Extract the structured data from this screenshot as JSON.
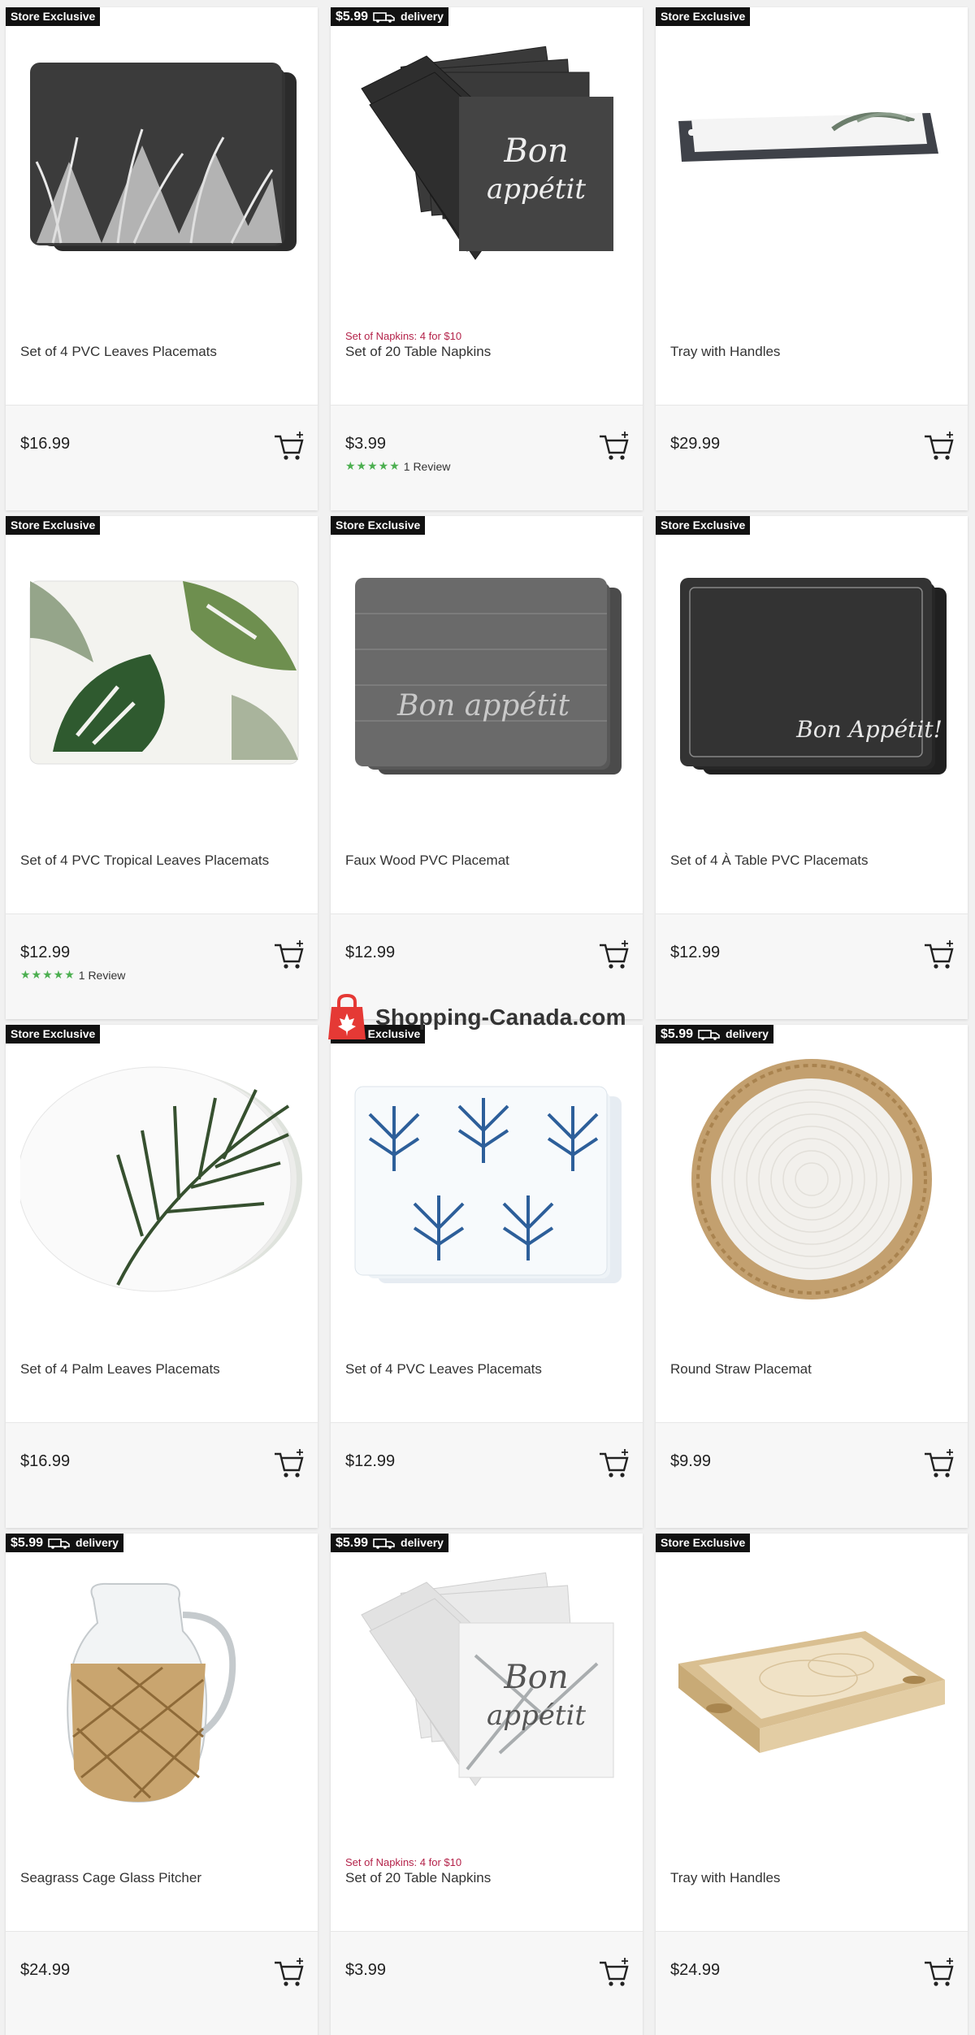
{
  "products": [
    {
      "badge": "Store Exclusive",
      "badge_type": "exclusive",
      "title": "Set of 4 PVC Leaves Placemats",
      "price": "$16.99",
      "promo": "",
      "rating": "",
      "image": "placemat-dark-leaves"
    },
    {
      "badge": "$5.99",
      "badge_type": "delivery",
      "title": "Set of 20 Table Napkins",
      "price": "$3.99",
      "promo": "Set of Napkins: 4 for $10",
      "rating": "1 Review",
      "image": "napkins-dark-bon-appetit"
    },
    {
      "badge": "Store Exclusive",
      "badge_type": "exclusive",
      "title": "Tray with Handles",
      "price": "$29.99",
      "promo": "",
      "rating": "",
      "image": "tray-dark"
    },
    {
      "badge": "Store Exclusive",
      "badge_type": "exclusive",
      "title": "Set of 4 PVC Tropical Leaves Placemats",
      "price": "$12.99",
      "promo": "",
      "rating": "1 Review",
      "image": "placemat-tropical"
    },
    {
      "badge": "Store Exclusive",
      "badge_type": "exclusive",
      "title": "Faux Wood PVC Placemat",
      "price": "$12.99",
      "promo": "",
      "rating": "",
      "image": "placemat-wood-bon-appetit"
    },
    {
      "badge": "Store Exclusive",
      "badge_type": "exclusive",
      "title": "Set of 4 À Table PVC Placemats",
      "price": "$12.99",
      "promo": "",
      "rating": "",
      "image": "placemat-slate-bon-appetit"
    },
    {
      "badge": "Store Exclusive",
      "badge_type": "exclusive",
      "title": "Set of 4 Palm Leaves Placemats",
      "price": "$16.99",
      "promo": "",
      "rating": "",
      "image": "placemat-round-palm"
    },
    {
      "badge": "Store Exclusive",
      "badge_type": "exclusive",
      "title": "Set of 4 PVC Leaves Placemats",
      "price": "$12.99",
      "promo": "",
      "rating": "",
      "image": "placemat-blue-leaves"
    },
    {
      "badge": "$5.99",
      "badge_type": "delivery",
      "title": "Round Straw Placemat",
      "price": "$9.99",
      "promo": "",
      "rating": "",
      "image": "placemat-straw-round"
    },
    {
      "badge": "$5.99",
      "badge_type": "delivery",
      "title": "Seagrass Cage Glass Pitcher",
      "price": "$24.99",
      "promo": "",
      "rating": "",
      "image": "pitcher-seagrass"
    },
    {
      "badge": "$5.99",
      "badge_type": "delivery",
      "title": "Set of 20 Table Napkins",
      "price": "$3.99",
      "promo": "Set of Napkins: 4 for $10",
      "rating": "",
      "image": "napkins-white-bon-appetit"
    },
    {
      "badge": "Store Exclusive",
      "badge_type": "exclusive",
      "title": "Tray with Handles",
      "price": "$24.99",
      "promo": "",
      "rating": "",
      "image": "tray-wood"
    }
  ],
  "delivery_label": "delivery",
  "watermark": "Shopping-Canada.com",
  "colors": {
    "badge_bg": "#111111",
    "promo": "#b4234a",
    "star": "#4caf50",
    "cart": "#222222",
    "watermark_red": "#e53935"
  }
}
